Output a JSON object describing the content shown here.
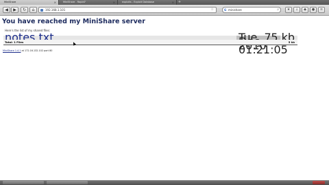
{
  "tabs": [
    {
      "label": "MiniShare"
    },
    {
      "label": "MiniShare - Rapid7"
    },
    {
      "label": "exploits - Exploit Database"
    }
  ],
  "navbar": {
    "url": "192.168.1.101",
    "search": "minishare"
  },
  "page": {
    "title": "You have reached my MiniShare server",
    "subtitle": "Here's the list of my shared files:",
    "files": [
      {
        "name": "notes.txt",
        "date": "Tue, 7 Dec 2010 01:21:05",
        "size": "5 kb"
      }
    ],
    "total_label": "Total: 1 Files",
    "total_size": "5 kb",
    "footer_link": "MiniShare 1.4.1",
    "footer_text": " at 172.16.132.102 port 80"
  }
}
